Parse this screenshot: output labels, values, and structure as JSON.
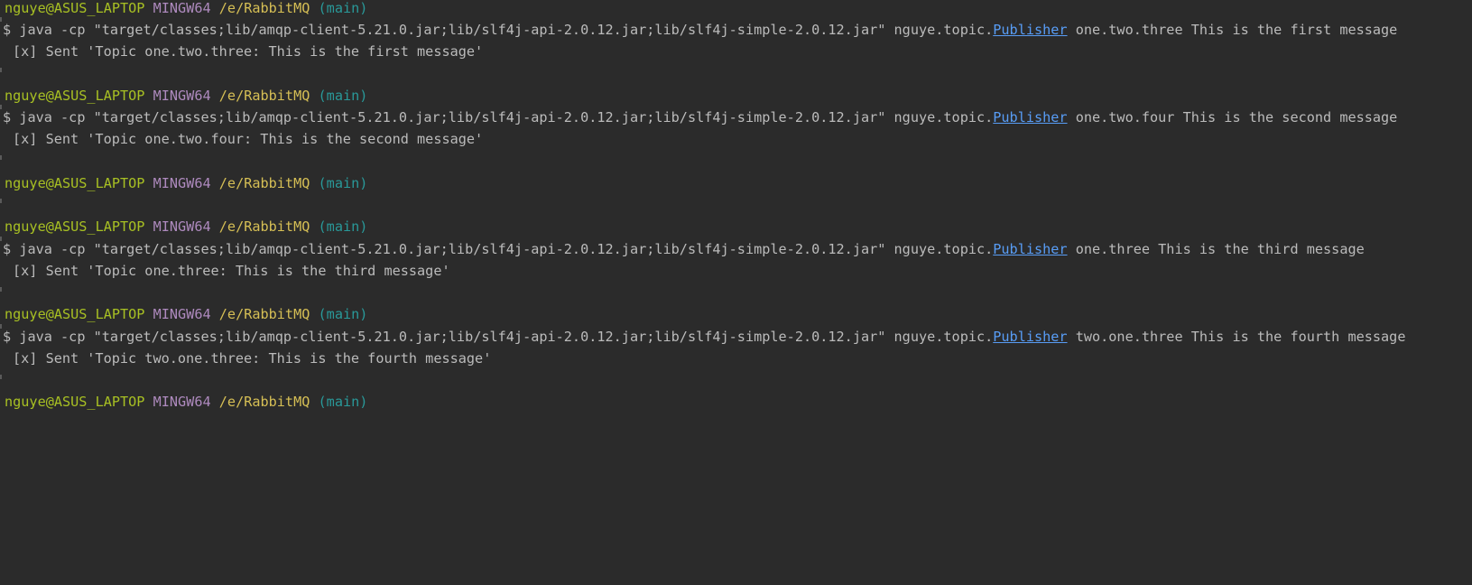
{
  "colors": {
    "background": "#2b2b2b",
    "text": "#bbbbbb",
    "user_host": "#a8c023",
    "system": "#ae8abe",
    "path": "#d6bf55",
    "branch": "#299999",
    "link": "#589df6"
  },
  "prompt": {
    "user_host": "nguye@ASUS_LAPTOP",
    "system": "MINGW64",
    "path": "/e/RabbitMQ",
    "branch": "(main)"
  },
  "command": {
    "dollar": "$",
    "prefix": "java -cp \"target/classes;lib/amqp-client-5.21.0.jar;lib/slf4j-api-2.0.12.jar;lib/slf4j-simple-2.0.12.jar\" nguye.topic.",
    "class_link": "Publisher"
  },
  "entries": [
    {
      "args": "one.two.three This is the first message",
      "output": "[x] Sent 'Topic one.two.three: This is the first message'"
    },
    {
      "args": "one.two.four This is the second message",
      "output": "[x] Sent 'Topic one.two.four: This is the second message'"
    },
    {
      "args": "one.three This is the third message",
      "output": "[x] Sent 'Topic one.three: This is the third message'"
    },
    {
      "args": "two.one.three This is the fourth message",
      "output": "[x] Sent 'Topic two.one.three: This is the fourth message'"
    }
  ]
}
